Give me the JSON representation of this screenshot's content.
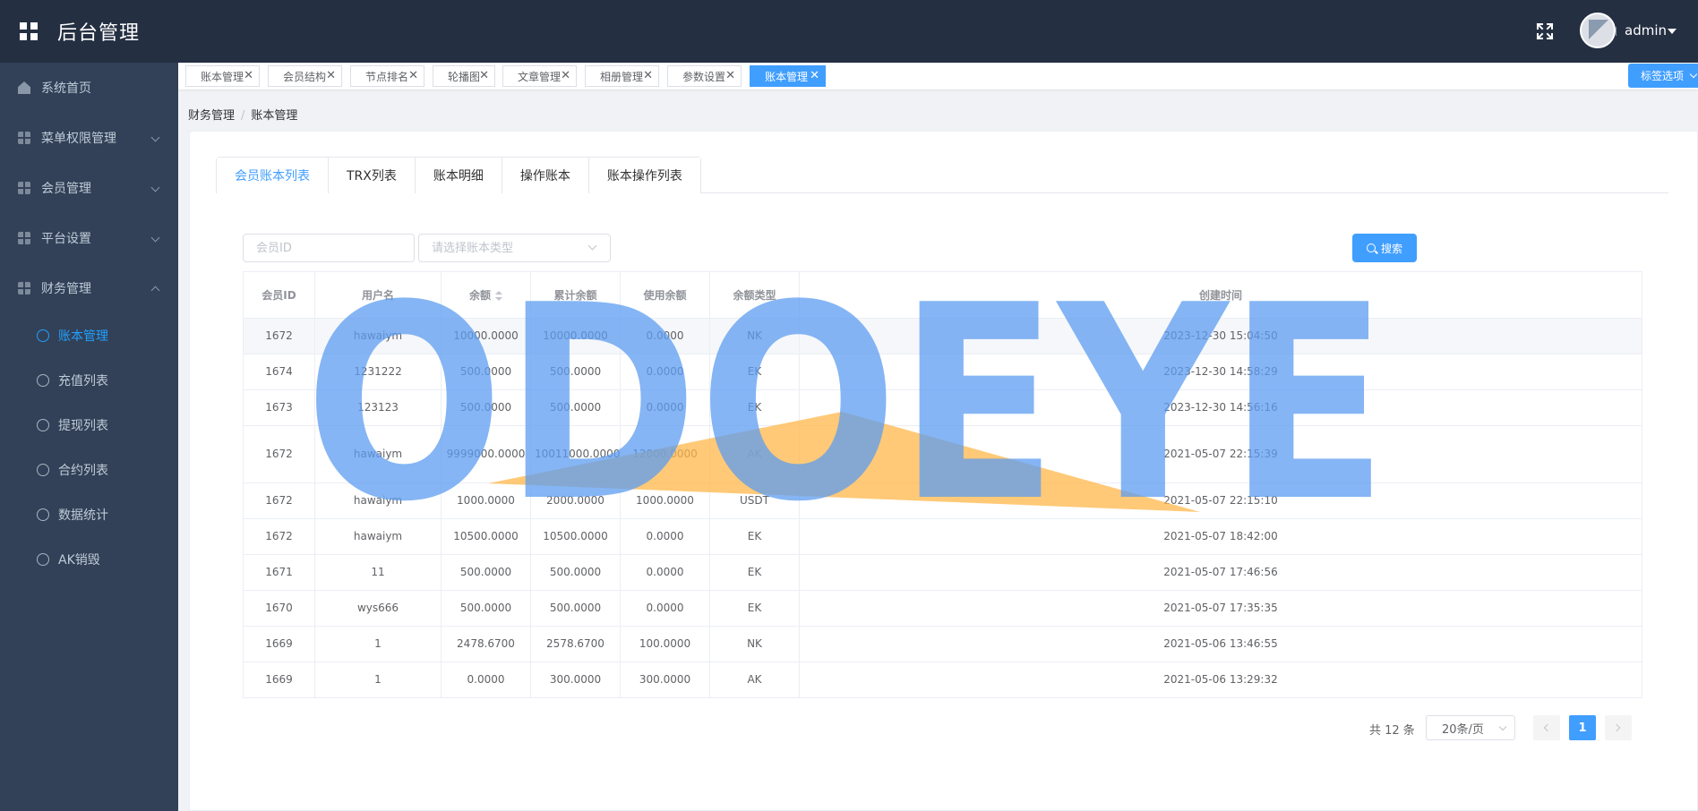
{
  "header": {
    "title": "后台管理",
    "user": "admin"
  },
  "sidebar": {
    "items": [
      {
        "label": "系统首页"
      },
      {
        "label": "菜单权限管理"
      },
      {
        "label": "会员管理"
      },
      {
        "label": "平台设置"
      },
      {
        "label": "财务管理"
      }
    ],
    "sub_items": [
      {
        "label": "账本管理"
      },
      {
        "label": "充值列表"
      },
      {
        "label": "提现列表"
      },
      {
        "label": "合约列表"
      },
      {
        "label": "数据统计"
      },
      {
        "label": "AK销毁"
      }
    ]
  },
  "tags": [
    {
      "label": "账本管理"
    },
    {
      "label": "会员结构"
    },
    {
      "label": "节点排名"
    },
    {
      "label": "轮播图"
    },
    {
      "label": "文章管理"
    },
    {
      "label": "相册管理"
    },
    {
      "label": "参数设置"
    },
    {
      "label": "账本管理"
    }
  ],
  "tag_options": "标签选项",
  "breadcrumb": {
    "parent": "财务管理",
    "current": "账本管理"
  },
  "tabs": [
    {
      "label": "会员账本列表"
    },
    {
      "label": "TRX列表"
    },
    {
      "label": "账本明细"
    },
    {
      "label": "操作账本"
    },
    {
      "label": "账本操作列表"
    }
  ],
  "filters": {
    "member_id_placeholder": "会员ID",
    "type_placeholder": "请选择账本类型",
    "search_label": "搜索"
  },
  "table": {
    "headers": [
      "会员ID",
      "用户名",
      "余额",
      "累计余额",
      "使用余额",
      "余额类型",
      "创建时间"
    ],
    "rows": [
      [
        "1672",
        "hawaiym",
        "10000.0000",
        "10000.0000",
        "0.0000",
        "NK",
        "2023-12-30 15:04:50"
      ],
      [
        "1674",
        "1231222",
        "500.0000",
        "500.0000",
        "0.0000",
        "EK",
        "2023-12-30 14:58:29"
      ],
      [
        "1673",
        "123123",
        "500.0000",
        "500.0000",
        "0.0000",
        "EK",
        "2023-12-30 14:56:16"
      ],
      [
        "1672",
        "hawaiym",
        "9999000.0000",
        "10011000.0000",
        "12000.0000",
        "AK",
        "2021-05-07 22:15:39"
      ],
      [
        "1672",
        "hawaiym",
        "1000.0000",
        "2000.0000",
        "1000.0000",
        "USDT",
        "2021-05-07 22:15:10"
      ],
      [
        "1672",
        "hawaiym",
        "10500.0000",
        "10500.0000",
        "0.0000",
        "EK",
        "2021-05-07 18:42:00"
      ],
      [
        "1671",
        "11",
        "500.0000",
        "500.0000",
        "0.0000",
        "EK",
        "2021-05-07 17:46:56"
      ],
      [
        "1670",
        "wys666",
        "500.0000",
        "500.0000",
        "0.0000",
        "EK",
        "2021-05-07 17:35:35"
      ],
      [
        "1669",
        "1",
        "2478.6700",
        "2578.6700",
        "100.0000",
        "NK",
        "2021-05-06 13:46:55"
      ],
      [
        "1669",
        "1",
        "0.0000",
        "300.0000",
        "300.0000",
        "AK",
        "2021-05-06 13:29:32"
      ]
    ]
  },
  "pagination": {
    "total": "共 12 条",
    "page_size": "20条/页",
    "current": "1"
  },
  "watermark": "ODOEYE",
  "colors": {
    "accent": "#409eff",
    "header_bg": "#242f42",
    "sidebar_bg": "#324157",
    "sidebar_active": "#20a0ff"
  },
  "icons": [
    "grid-icon",
    "fullscreen-icon",
    "home-icon",
    "chevron-down-icon",
    "circle-icon",
    "search-icon",
    "close-icon"
  ]
}
